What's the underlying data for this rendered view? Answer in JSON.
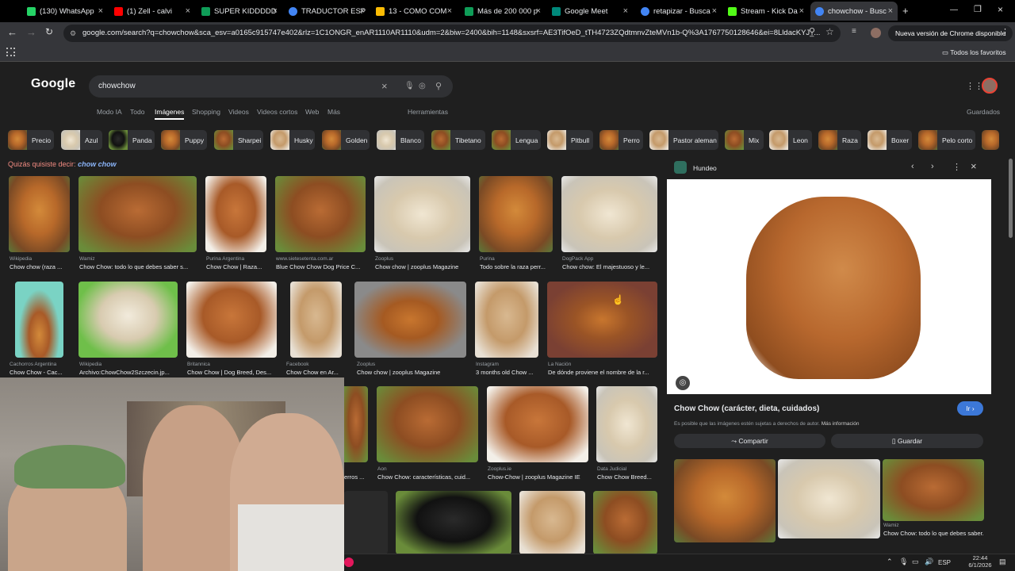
{
  "tabs": [
    {
      "label": "(130) WhatsApp",
      "color": "#25d366"
    },
    {
      "label": "(1) Zell - calvi",
      "color": "#ff0000"
    },
    {
      "label": "SUPER KIDDDDD",
      "color": "#0f9d58"
    },
    {
      "label": "TRADUCTOR ESP",
      "color": "#4285f4"
    },
    {
      "label": "13 - COMO COM",
      "color": "#fbbc04"
    },
    {
      "label": "Más de 200 000 p",
      "color": "#0f9d58"
    },
    {
      "label": "Google Meet",
      "color": "#00897b"
    },
    {
      "label": "retapizar - Busca",
      "color": "#4285f4"
    },
    {
      "label": "Stream - Kick Da",
      "color": "#53fc18"
    },
    {
      "label": "chowchow - Busc",
      "color": "#4285f4"
    }
  ],
  "address": {
    "url": "google.com/search?q=chowchow&sca_esv=a0165c915747e402&rlz=1C1ONGR_enAR1110AR1110&udm=2&biw=2400&bih=1148&sxsrf=AE3TifOeD_tTH4723ZQdtmnvZteMVn1b-Q%3A1767750128646&ei=8LldacKYJ_...",
    "update_label": "Nueva versión de Chrome disponible"
  },
  "bookmarks": {
    "all_label": "Todos los favoritos"
  },
  "google": {
    "logo": "Google",
    "query": "chowchow",
    "nav": [
      "Modo IA",
      "Todo",
      "Imágenes",
      "Shopping",
      "Videos",
      "Videos cortos",
      "Web",
      "Más"
    ],
    "tools": "Herramientas",
    "saved": "Guardados",
    "suggest_prefix": "Quizás quisiste decir:",
    "suggest_term": "chow chow"
  },
  "chips": [
    "Precio",
    "Azul",
    "Panda",
    "Puppy",
    "Sharpei",
    "Husky",
    "Golden",
    "Blanco",
    "Tibetano",
    "Lengua",
    "Pitbull",
    "Perro",
    "Pastor aleman",
    "Mix",
    "Leon",
    "Raza",
    "Boxer",
    "Pelo corto"
  ],
  "results_row1": [
    {
      "source": "Wikipedia",
      "caption": "Chow chow (raza ..."
    },
    {
      "source": "Wamiz",
      "caption": "Chow Chow: todo lo que debes saber s..."
    },
    {
      "source": "Purina Argentina",
      "caption": "Chow Chow | Raza..."
    },
    {
      "source": "www.sietesetenta.com.ar",
      "caption": "Blue Chow Chow Dog Price C..."
    },
    {
      "source": "Zooplus",
      "caption": "Chow chow | zooplus Magazine"
    },
    {
      "source": "Purina",
      "caption": "Todo sobre la raza perr..."
    },
    {
      "source": "DogPack App",
      "caption": "Chow chow: El majestuoso y le..."
    }
  ],
  "results_row2": [
    {
      "source": "Cachorros Argentina",
      "caption": "Chow Chow - Cac..."
    },
    {
      "source": "Wikipedia",
      "caption": "Archivo:ChowChow2Szczecin.jp..."
    },
    {
      "source": "Britannica",
      "caption": "Chow Chow | Dog Breed, Des..."
    },
    {
      "source": "Facebook",
      "caption": "Chow Chow en Ar..."
    },
    {
      "source": "Zooplus",
      "caption": "Chow chow | zooplus Magazine"
    },
    {
      "source": "Instagram",
      "caption": "3 months old Chow ..."
    },
    {
      "source": "La Nación",
      "caption": "De dónde proviene el nombre de la r..."
    }
  ],
  "results_row3": [
    {
      "source": "",
      "caption": "erros ..."
    },
    {
      "source": "Aon",
      "caption": "Chow Chow: características, cuid..."
    },
    {
      "source": "Zooplus.ie",
      "caption": "Chow-Chow | zooplus Magazine IE"
    },
    {
      "source": "Data Judicial",
      "caption": "Chow Chow Breed..."
    }
  ],
  "panel": {
    "source": "Hundeo",
    "title": "Chow Chow (carácter, dieta, cuidados)",
    "go_label": "Ir",
    "notice": "Es posible que las imágenes estén sujetas a derechos de autor.",
    "more_info": "Más información",
    "share": "Compartir",
    "save": "Guardar",
    "related_source": "Wamiz",
    "related_caption": "Chow Chow: todo lo que debes saber..."
  },
  "taskbar": {
    "lang": "ESP",
    "time": "22:44",
    "date": "6/1/2026"
  }
}
